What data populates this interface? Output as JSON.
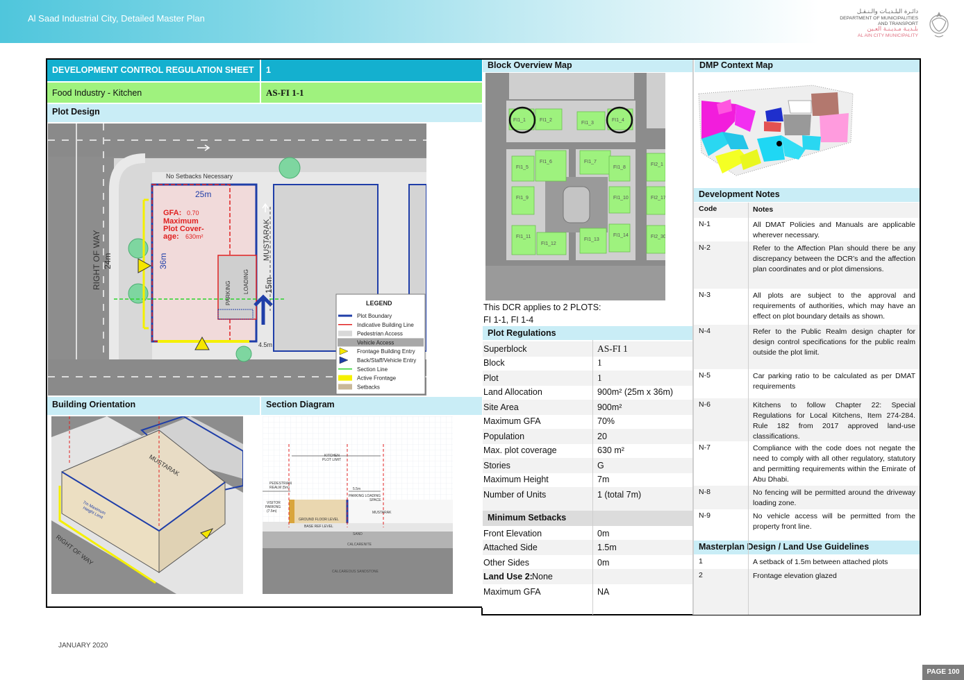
{
  "header": {
    "doc_title": "Al Saad Industrial City, Detailed Master Plan",
    "logo_ar_1": "دائـرة البلـديـات والـنـقـل",
    "logo_en_1": "DEPARTMENT OF MUNICIPALITIES",
    "logo_en_2": "AND TRANSPORT",
    "logo_ar_2": "بلـديـة مـديـنـة العـين",
    "logo_en_3": "AL AIN CITY MUNICIPALITY"
  },
  "sheet": {
    "title": "DEVELOPMENT CONTROL REGULATION SHEET",
    "number": "1",
    "land_use": "Food Industry - Kitchen",
    "code": "AS-FI 1-1",
    "plot_design": "Plot Design",
    "building_orientation": "Building Orientation",
    "section_diagram": "Section Diagram"
  },
  "plot_diagram": {
    "no_setbacks": "No Setbacks Necessary",
    "width": "25m",
    "depth": "36m",
    "gfa_label": "GFA:",
    "gfa_value": "0.70",
    "max_cov_1": "Maximum",
    "max_cov_2": "Plot Cover-",
    "max_cov_3": "age:",
    "max_cov_value": "630m²",
    "row_1": "RIGHT OF WAY",
    "row_2": "24m",
    "mustarak": "MUSTARAK",
    "parking": "PARKING",
    "loading": "LOADING",
    "dim_15": "15m",
    "dim_45": "4.5m",
    "legend_title": "LEGEND",
    "legend": [
      {
        "label": "Plot Boundary",
        "color": "#1f3ea8"
      },
      {
        "label": "Indicative Building Line",
        "color": "#e02020"
      },
      {
        "label": "Pedestrian Access",
        "color": "#d8d8d8"
      },
      {
        "label": "Vehicle Access",
        "color": "#a8a8a8"
      },
      {
        "label": "Frontage Building Entry",
        "color": "#f5e600"
      },
      {
        "label": "Back/Staff/Vehicle Entry",
        "color": "#1f3ea8"
      },
      {
        "label": "Section Line",
        "color": "#2bd42b"
      },
      {
        "label": "Active Frontage",
        "color": "#f5f000"
      },
      {
        "label": "Setbacks",
        "color": "#c8b89a"
      }
    ]
  },
  "block_map": {
    "title": "Block Overview Map",
    "plots": [
      "FI1_1",
      "FI1_2",
      "FI1_3",
      "FI1_4",
      "FI1_5",
      "FI1_6",
      "FI1_7",
      "FI1_8",
      "FI2_1",
      "FI1_9",
      "FI1_10",
      "FI2_17",
      "FI1_11",
      "FI1_12",
      "FI1_13",
      "FI1_14",
      "FI2_30"
    ],
    "applies_1": "This DCR applies to 2 PLOTS:",
    "applies_2": "FI 1-1, FI 1-4"
  },
  "dmp_context": {
    "title": "DMP Context Map"
  },
  "orientation_diagram": {
    "mustarak": "MUSTARAK",
    "height": "7m Maximum",
    "height_2": "Height Limit",
    "row": "RIGHT OF WAY"
  },
  "section_diagram": {
    "kitchen_1": "KITCHEN",
    "kitchen_2": "PLOT LIMIT",
    "ped_1": "PEDESTRIAN",
    "ped_2": "REALM (5m)",
    "dim_55": "5.5m",
    "parking_loading": "PARKING LOADING",
    "space": "SPACE",
    "visitor_1": "VISITOR",
    "visitor_2": "PARKING",
    "visitor_3": "(7.5m)",
    "mustarak": "MUSTARAK",
    "gfl": "GROUND FLOOR LEVEL",
    "brl": "BASE REF LEVEL",
    "sand": "SAND",
    "calcarenite": "CALCARENITE",
    "sandstone": "CALCAREOUS SANDSTONE"
  },
  "plot_regulations": {
    "title": "Plot Regulations",
    "rows": [
      {
        "k": "Superblock",
        "v": "AS-FI 1"
      },
      {
        "k": "Block",
        "v": "1"
      },
      {
        "k": "Plot",
        "v": "1"
      },
      {
        "k": "Land Allocation",
        "v": "900m² (25m x 36m)"
      },
      {
        "k": "Site Area",
        "v": "900m²"
      },
      {
        "k": "Maximum GFA",
        "v": "70%"
      },
      {
        "k": "Population",
        "v": "20"
      },
      {
        "k": "Max. plot coverage",
        "v": "630 m²"
      },
      {
        "k": "Stories",
        "v": "G"
      },
      {
        "k": "Maximum Height",
        "v": "7m"
      },
      {
        "k": "Number of Units",
        "v": "1 (total 7m)"
      }
    ],
    "setbacks_title": "Minimum Setbacks",
    "setbacks": [
      {
        "k": "Front Elevation",
        "v": "0m"
      },
      {
        "k": "Attached Side",
        "v": "1.5m"
      },
      {
        "k": "Other Sides",
        "v": "0m"
      }
    ],
    "land_use_2_label": "Land Use 2:",
    "land_use_2_value": "None",
    "lu2_rows": [
      {
        "k": "Maximum GFA",
        "v": "NA"
      }
    ]
  },
  "dev_notes": {
    "title": "Development Notes",
    "code_hdr": "Code",
    "notes_hdr": "Notes",
    "notes": [
      {
        "c": "N-1",
        "t": "All DMAT Policies and Manuals are applicable wherever necessary."
      },
      {
        "c": "N-2",
        "t": "Refer to the Affection Plan should there be any discrepancy between the DCR’s and the affection plan coordinates and or plot dimensions."
      },
      {
        "c": "N-3",
        "t": "All plots are subject to the approval and requirements of authorities, which may have an effect on plot boundary details as shown."
      },
      {
        "c": "N-4",
        "t": "Refer to the Public Realm design chapter for design control specifications for the public realm outside the plot limit."
      },
      {
        "c": "N-5",
        "t": "Car parking ratio to be calculated as per DMAT requirements"
      },
      {
        "c": "N-6",
        "t": "Kitchens to follow Chapter 22: Special Regulations for Local Kitchens, Item 274-284. Rule 182 from 2017 approved land-use classifications."
      },
      {
        "c": "N-7",
        "t": "Compliance with the code does not negate the need to comply with all other regulatory, statutory and permitting requirements within the Emirate of Abu Dhabi."
      },
      {
        "c": "N-8",
        "t": "No fencing will be permitted around the driveway loading zone."
      },
      {
        "c": "N-9",
        "t": "No vehicle access will be permitted from the property front line."
      }
    ]
  },
  "guidelines": {
    "title": "Masterplan Design / Land Use Guidelines",
    "items": [
      {
        "c": "1",
        "t": "A setback of 1.5m between attached plots"
      },
      {
        "c": "2",
        "t": "Frontage elevation glazed"
      }
    ]
  },
  "footer": {
    "date": "JANUARY 2020",
    "page": "PAGE 100"
  }
}
